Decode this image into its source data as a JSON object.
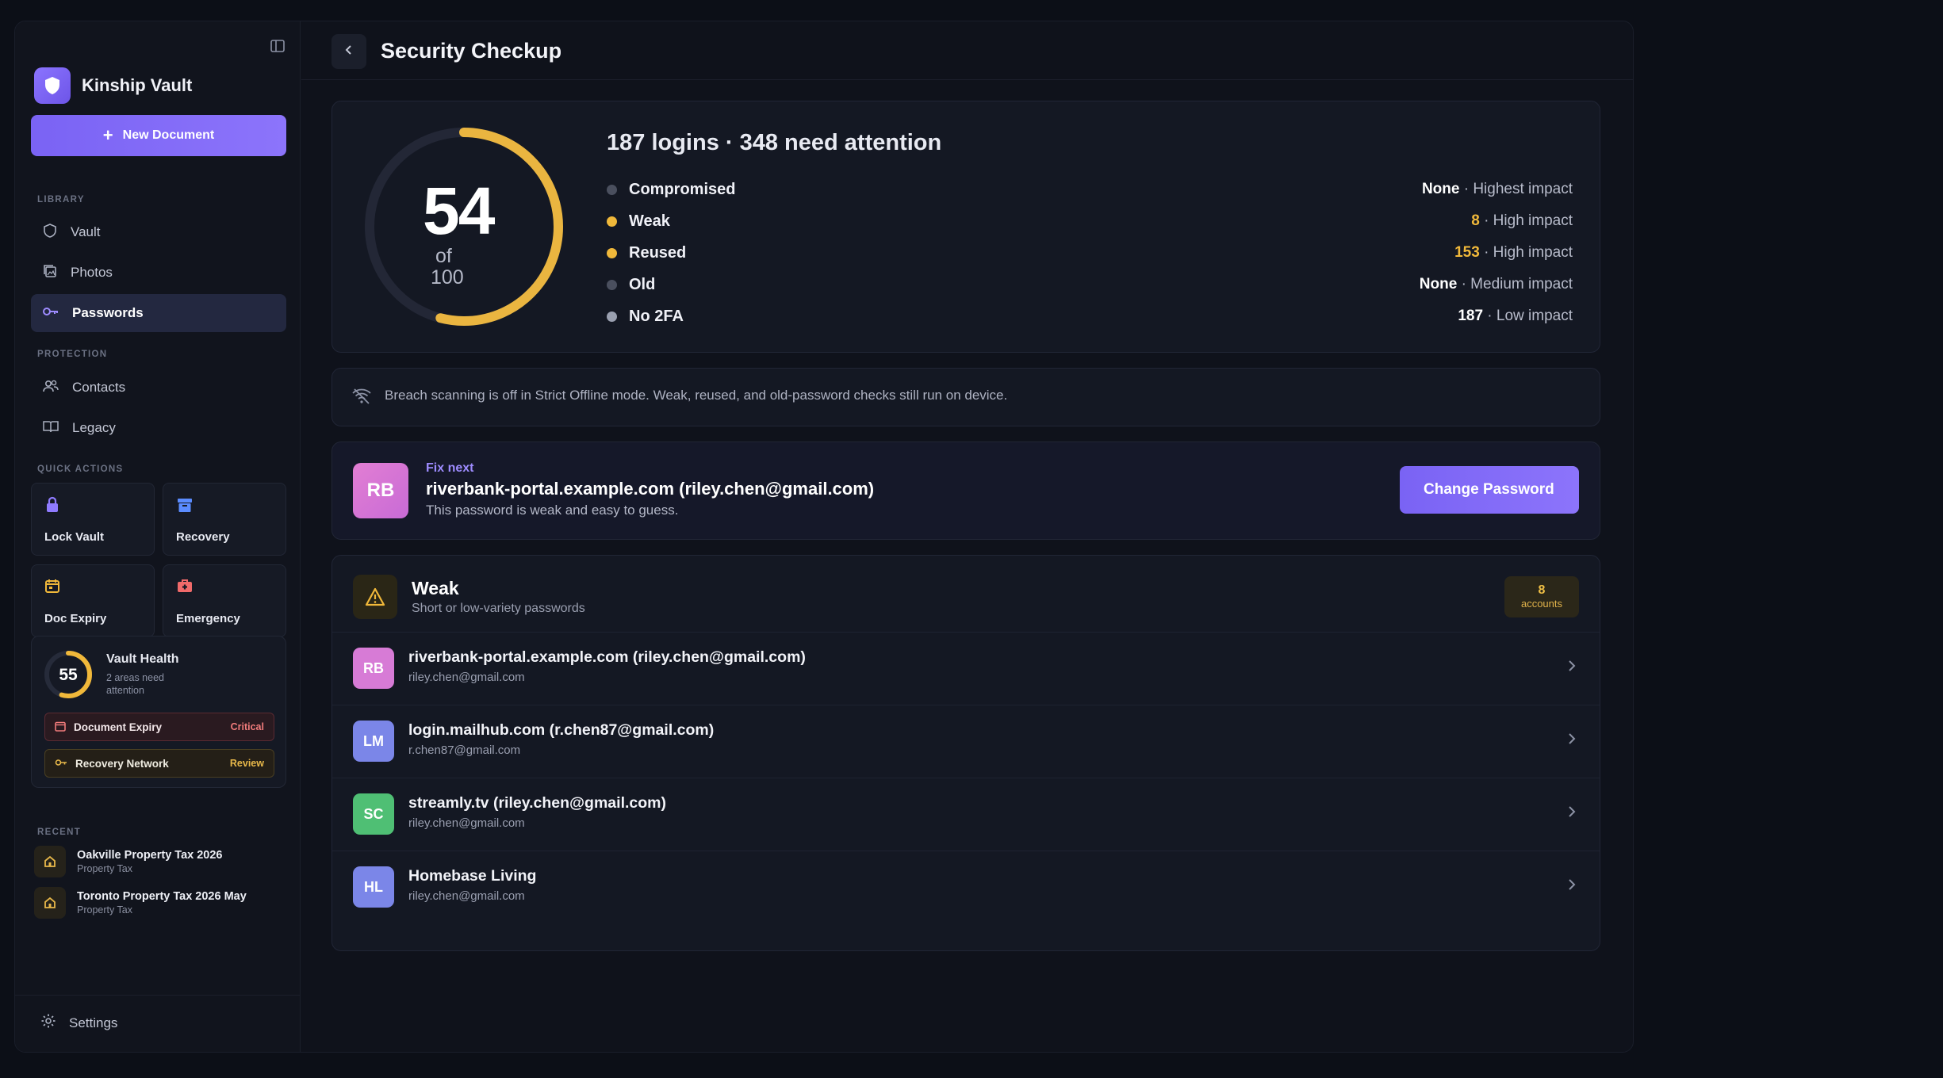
{
  "app": {
    "name": "Kinship Vault",
    "new_document": "New Document"
  },
  "sidebar": {
    "library_label": "LIBRARY",
    "library_items": [
      {
        "label": "Vault",
        "icon": "shield-icon"
      },
      {
        "label": "Photos",
        "icon": "photos-icon"
      },
      {
        "label": "Passwords",
        "icon": "key-icon",
        "active": true
      }
    ],
    "protection_label": "PROTECTION",
    "protection_items": [
      {
        "label": "Contacts",
        "icon": "contacts-icon"
      },
      {
        "label": "Legacy",
        "icon": "book-icon"
      }
    ],
    "quick_actions_label": "QUICK ACTIONS",
    "quick_actions": [
      {
        "label": "Lock Vault",
        "icon": "lock-icon",
        "color": "#8f7bff"
      },
      {
        "label": "Recovery",
        "icon": "archive-icon",
        "color": "#5b8cff"
      },
      {
        "label": "Doc Expiry",
        "icon": "calendar-icon",
        "color": "#f0b83a"
      },
      {
        "label": "Emergency",
        "icon": "medkit-icon",
        "color": "#f06a6a"
      }
    ],
    "health": {
      "score": "55",
      "score_fraction": 0.55,
      "title": "Vault Health",
      "subtitle": "2 areas need attention",
      "rows": [
        {
          "label": "Document Expiry",
          "tag": "Critical",
          "color": "#f07b7b"
        },
        {
          "label": "Recovery Network",
          "tag": "Review",
          "color": "#e8b84a"
        }
      ]
    },
    "recent_label": "RECENT",
    "recent": [
      {
        "title": "Oakville Property Tax 2026",
        "subtitle": "Property Tax"
      },
      {
        "title": "Toronto Property Tax 2026 May",
        "subtitle": "Property Tax"
      }
    ],
    "settings": "Settings"
  },
  "page": {
    "title": "Security Checkup"
  },
  "score": {
    "value": "54",
    "of": "of",
    "max": "100",
    "fraction": 0.54,
    "summary": "187 logins · 348 need attention",
    "risks": [
      {
        "name": "Compromised",
        "count": "None",
        "impact": "· Highest impact",
        "dot": "#4a4f5e",
        "count_color": "#ffffff"
      },
      {
        "name": "Weak",
        "count": "8",
        "impact": "· High impact",
        "dot": "#f0b83a",
        "count_color": "#f0b83a"
      },
      {
        "name": "Reused",
        "count": "153",
        "impact": "· High impact",
        "dot": "#f0b83a",
        "count_color": "#f0b83a"
      },
      {
        "name": "Old",
        "count": "None",
        "impact": "· Medium impact",
        "dot": "#4a4f5e",
        "count_color": "#ffffff"
      },
      {
        "name": "No 2FA",
        "count": "187",
        "impact": "· Low impact",
        "dot": "#9aa0b0",
        "count_color": "#ffffff"
      }
    ]
  },
  "notice": {
    "text": "Breach scanning is off in Strict Offline mode. Weak, reused, and old-password checks still run on device."
  },
  "fix_next": {
    "label": "Fix next",
    "initials": "RB",
    "title": "riverbank-portal.example.com (riley.chen@gmail.com)",
    "description": "This password is weak and easy to guess.",
    "button": "Change Password"
  },
  "weak_group": {
    "title": "Weak",
    "subtitle": "Short or low-variety passwords",
    "count": "8",
    "count_label": "accounts",
    "accounts": [
      {
        "initials": "RB",
        "title": "riverbank-portal.example.com (riley.chen@gmail.com)",
        "email": "riley.chen@gmail.com",
        "color": "#d77bd6"
      },
      {
        "initials": "LM",
        "title": "login.mailhub.com (r.chen87@gmail.com)",
        "email": "r.chen87@gmail.com",
        "color": "#7b86e8"
      },
      {
        "initials": "SC",
        "title": "streamly.tv (riley.chen@gmail.com)",
        "email": "riley.chen@gmail.com",
        "color": "#4fbf74"
      },
      {
        "initials": "HL",
        "title": "Homebase Living",
        "email": "riley.chen@gmail.com",
        "color": "#7b86e8"
      }
    ]
  }
}
